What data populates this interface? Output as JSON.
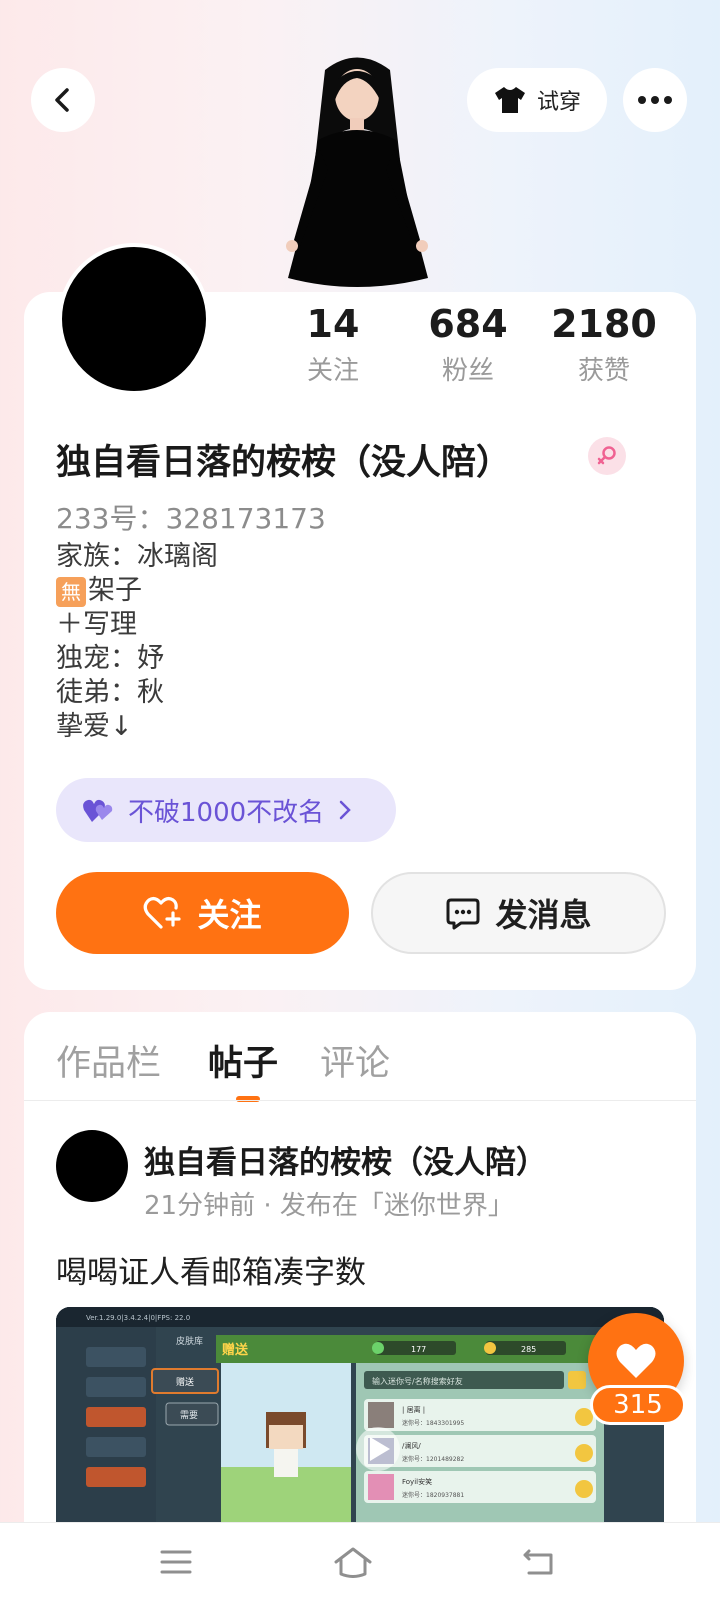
{
  "header": {
    "tryon_label": "试穿"
  },
  "stats": [
    {
      "value": "14",
      "label": "关注"
    },
    {
      "value": "684",
      "label": "粉丝"
    },
    {
      "value": "2180",
      "label": "获赞"
    }
  ],
  "profile": {
    "username": "独自看日落的桉桉（没人陪）",
    "uid": "233号：328173173",
    "bio_lines": [
      "家族：冰璃阁",
      "架子",
      "＋写理",
      "独宠：妤",
      "徒弟：秋",
      "挚爱↓"
    ],
    "bio_tag_char": "無",
    "badge_label": "不破1000不改名",
    "follow_label": "关注",
    "message_label": "发消息"
  },
  "tabs": [
    {
      "label": "作品栏",
      "active": false
    },
    {
      "label": "帖子",
      "active": true
    },
    {
      "label": "评论",
      "active": false
    }
  ],
  "post": {
    "author": "独自看日落的桉桉（没人陪）",
    "meta": "21分钟前 · 发布在「迷你世界」",
    "text": "喝喝证人看邮箱凑字数",
    "like_count": "315",
    "media": {
      "tab_left": "皮肤库",
      "panel_title": "赠送",
      "search_placeholder": "输入迷你号/名称搜索好友",
      "coin1": "177",
      "coin2": "285",
      "side_btn1": "赠送",
      "side_btn2": "需要",
      "friends": [
        {
          "name": "| 居离 |",
          "id": "迷你号：1843301995"
        },
        {
          "name": "/澜风/",
          "id": "迷你号：1201489282"
        },
        {
          "name": "Foyil安笑",
          "id": "迷你号：1820937881"
        }
      ],
      "version": "Ver.1.29.0|3.4.2.4|0|FPS: 22.0"
    }
  },
  "colors": {
    "accent": "#ff7212",
    "badge_text": "#6a53d6",
    "badge_bg": "#e9e6fb"
  }
}
